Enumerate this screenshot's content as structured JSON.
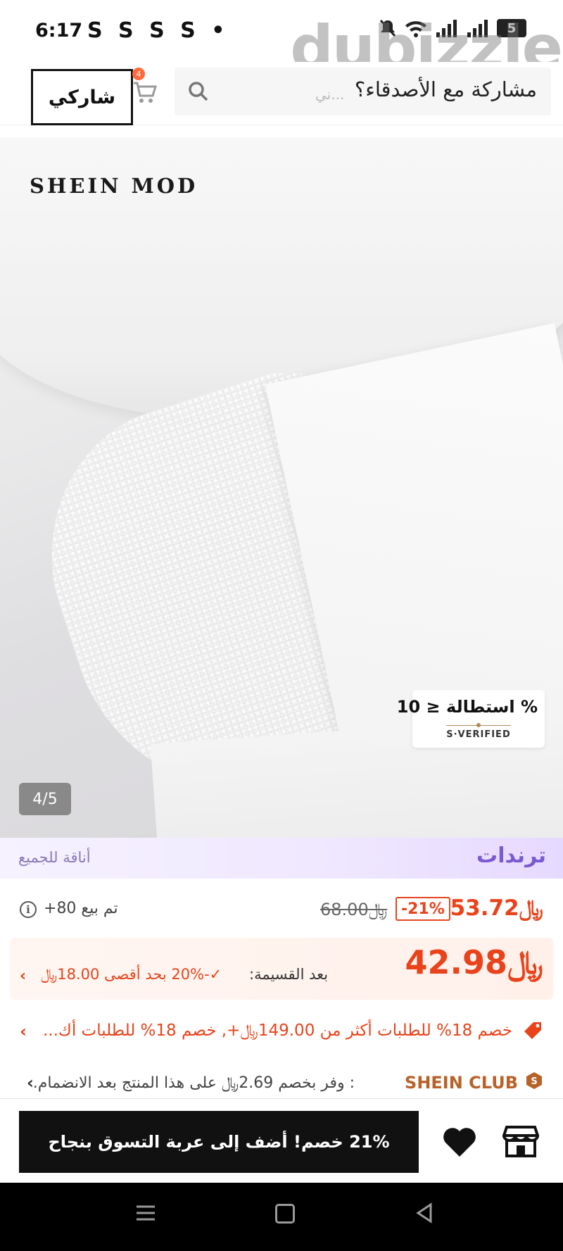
{
  "status_bar": {
    "time": "6:17",
    "app_icons": "S S S S •",
    "battery": "5"
  },
  "watermark": "dubizzle",
  "top_bar": {
    "share_button": "شاركي",
    "cart_badge": "4",
    "search_text": "مشاركة مع الأصدقاء؟",
    "search_placeholder": "...ني"
  },
  "product_image": {
    "brand": "SHEIN MOD",
    "stretch_label": "% استطالة ≤ 10",
    "verified_label": "S·VERIFIED",
    "counter": "4/5"
  },
  "trends": {
    "title": "ترندات",
    "subtitle": "أناقة للجميع"
  },
  "price": {
    "current": "53.72﷼",
    "discount": "-21%",
    "original": "68.00﷼",
    "sold": "تم بيع 80+"
  },
  "coupon": {
    "price": "42.98﷼",
    "after_label": "بعد القسيمة:",
    "detail": "✓-20% بحد أقصى 18.00﷼"
  },
  "promo": {
    "text": "خصم 18% للطلبات أكثر من 149.00﷼+,  خصم 18% للطلبات أك..."
  },
  "club": {
    "name": "SHEIN CLUB",
    "text": ": وفر بخصم 2.69﷼ على هذا المنتج بعد الانضمام."
  },
  "action_bar": {
    "add_to_cart": "21% خصم! أضف إلى عربة التسوق بنجاح"
  },
  "colors": {
    "accent": "#e8431b",
    "trends": "#7b5ad0",
    "club": "#b8622a"
  }
}
